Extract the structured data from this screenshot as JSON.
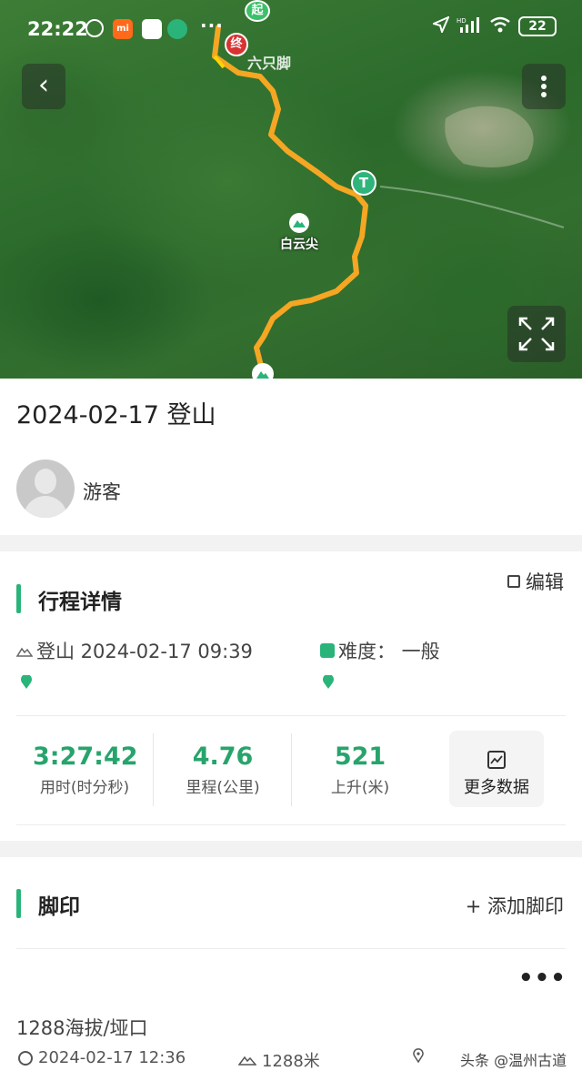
{
  "status_bar": {
    "time": "22:22",
    "dots": "···",
    "network": "HD",
    "battery": "22"
  },
  "map": {
    "marker_start": "起",
    "marker_end": "终",
    "marker_t": "T",
    "watermark": "六只脚",
    "peak_name": "白云尖",
    "route_color": "#f5a623"
  },
  "trip": {
    "title": "2024-02-17 登山",
    "user": "游客"
  },
  "details": {
    "section_title": "行程详情",
    "edit_label": "编辑",
    "activity": "登山 2024-02-17 09:39",
    "difficulty": "难度： 一般",
    "stats": [
      {
        "value": "3:27:42",
        "label": "用时(时分秒)"
      },
      {
        "value": "4.76",
        "label": "里程(公里)"
      },
      {
        "value": "521",
        "label": "上升(米)"
      }
    ],
    "more_data_label": "更多数据"
  },
  "footprints": {
    "section_title": "脚印",
    "add_label": "+ 添加脚印",
    "ellipsis": "•••",
    "item": {
      "title": "1288海拔/垭口",
      "time": "2024-02-17 12:36",
      "altitude": "1288米"
    }
  },
  "watermark": "头条 @温州古道",
  "colors": {
    "accent": "#2ab47a",
    "stat_green": "#27a46c"
  }
}
